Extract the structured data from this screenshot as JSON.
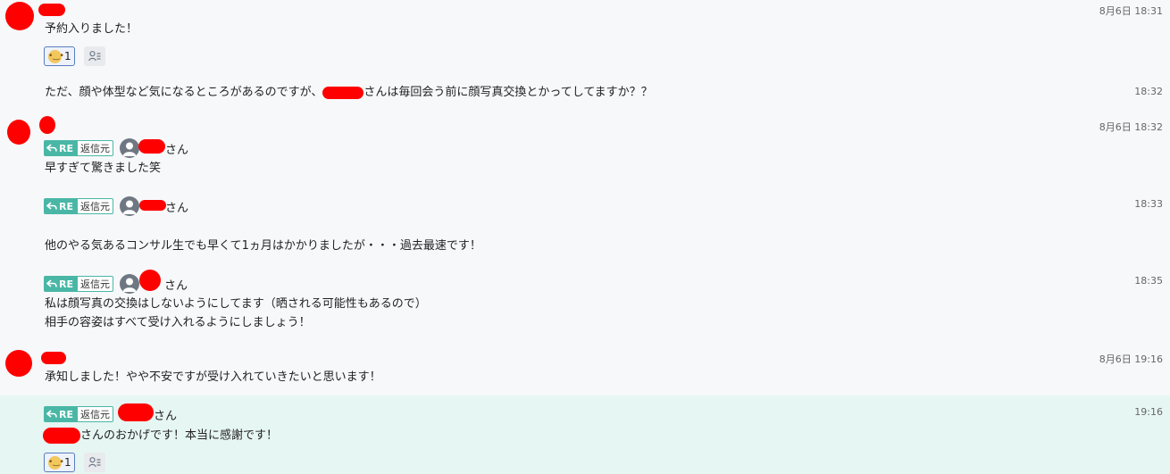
{
  "messages": [
    {
      "time": "8月6日 18:31",
      "text": "予約入りました！",
      "reaction_count": "1"
    },
    {
      "time": "18:32",
      "text_before": "ただ、顔や体型など気になるところがあるのですが、",
      "text_after": "さんは毎回会う前に顔写真交換とかってしてますか？？"
    },
    {
      "time": "8月6日 18:32",
      "re_label": "RE",
      "source_label": "返信元",
      "san": "さん",
      "text": "早すぎて驚きました笑"
    },
    {
      "time": "18:33",
      "re_label": "RE",
      "source_label": "返信元",
      "san": "さん"
    },
    {
      "text": "他のやる気あるコンサル生でも早くて1ヵ月はかかりましたが・・・過去最速です！"
    },
    {
      "time": "18:35",
      "re_label": "RE",
      "source_label": "返信元",
      "san": "さん",
      "line1": "私は顔写真の交換はしないようにしてます（晒される可能性もあるので）",
      "line2": "相手の容姿はすべて受け入れるようにしましょう！"
    },
    {
      "time": "8月6日 19:16",
      "text": "承知しました！やや不安ですが受け入れていきたいと思います！"
    },
    {
      "time": "19:16",
      "re_label": "RE",
      "source_label": "返信元",
      "san": "さん",
      "text_after": "さんのおかげです！本当に感謝です！",
      "reaction_count": "1"
    }
  ],
  "colors": {
    "re_badge": "#4ab7a6",
    "highlight": "#e6f6f3",
    "redaction": "#ff0000"
  },
  "icons": {
    "reaction_emoji": "fearful-face-icon",
    "reaction_users": "user-list-icon",
    "reply": "reply-arrow-icon",
    "user": "user-avatar-icon"
  }
}
